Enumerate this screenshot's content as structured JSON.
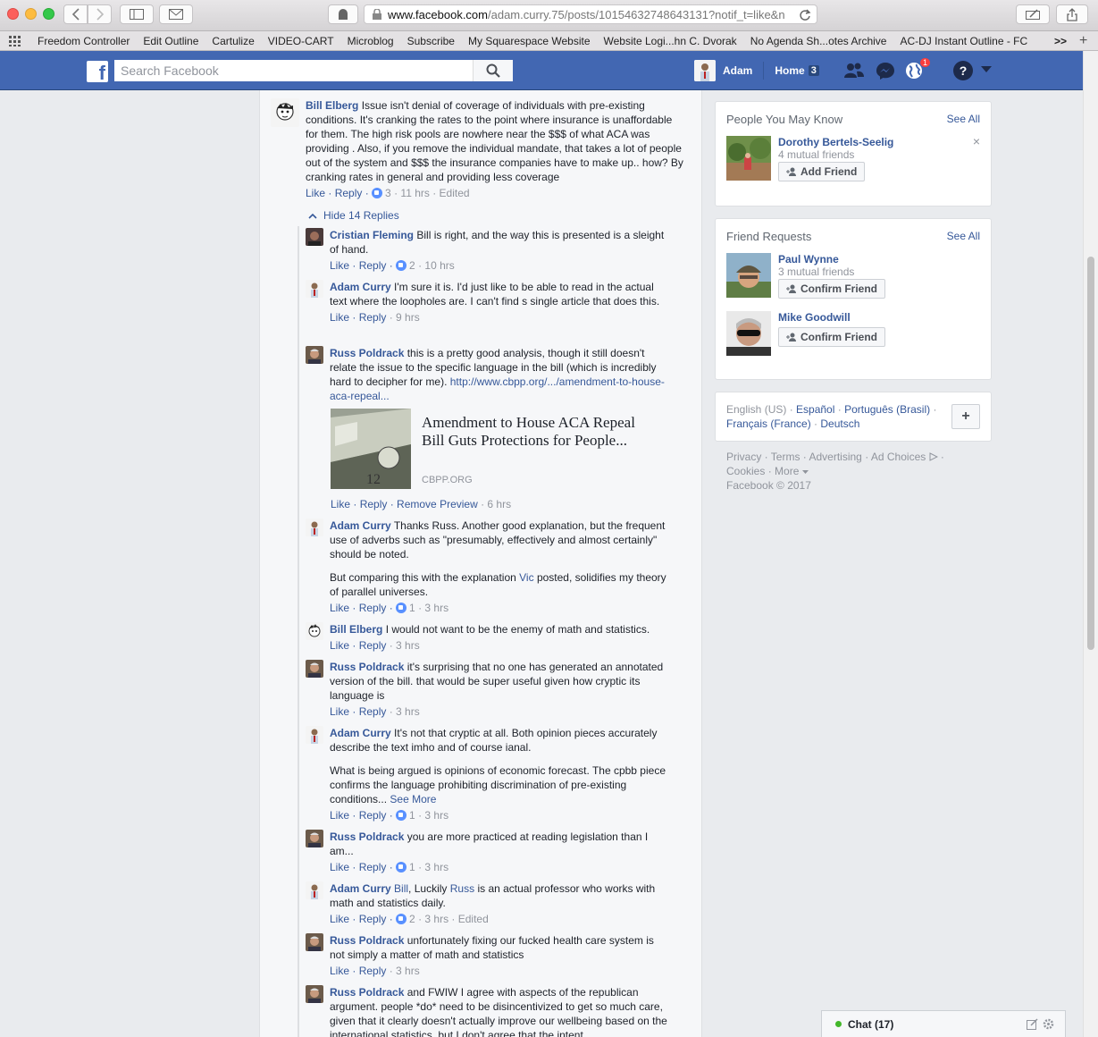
{
  "browser": {
    "url_host": "www.facebook.com",
    "url_path": "/adam.curry.75/posts/10154632748643131?notif_t=like&n",
    "bookmarks": [
      "Freedom Controller",
      "Edit Outline",
      "Cartulize",
      "VIDEO-CART",
      "Microblog",
      "Subscribe",
      "My Squarespace Website",
      "Website Logi...hn C. Dvorak",
      "No Agenda Sh...otes Archive",
      "AC-DJ Instant Outline - FC"
    ],
    "more_bookmarks": ">>",
    "add_tab": "+"
  },
  "fb_bar": {
    "logo": "f",
    "search_placeholder": "Search Facebook",
    "user_name": "Adam",
    "home_label": "Home",
    "home_count": "3",
    "notif_count": "1",
    "help": "?"
  },
  "comments": {
    "root": {
      "author": "Bill Elberg",
      "text": "Issue isn't denial of coverage of individuals with pre-existing conditions. It's cranking the rates to the point where insurance is unaffordable for them. The high risk pools are nowhere near the $$$ of what ACA was providing . Also, if you remove the individual mandate, that takes a lot of people out of the system and $$$ the insurance companies have to make up.. how? By cranking rates in general and providing less coverage",
      "like": "Like",
      "reply": "Reply",
      "likes": "3",
      "meta": "11 hrs · Edited"
    },
    "hide_replies": "Hide 14 Replies",
    "replies": [
      {
        "author": "Cristian Fleming",
        "text": "Bill is right, and the way this is presented is a sleight of hand.",
        "like": "Like",
        "reply": "Reply",
        "likes": "2",
        "meta": "10 hrs"
      },
      {
        "author": "Adam Curry",
        "text": "I'm sure it is. I'd just like to be able to read in the actual text where the loopholes are. I can't find s single article that does this.",
        "like": "Like",
        "reply": "Reply",
        "likes": "",
        "meta": "9 hrs"
      },
      {
        "author": "Russ Poldrack",
        "text": "this is a pretty good analysis, though it still doesn't relate the issue to the specific language in the bill (which is incredibly hard to decipher for me).",
        "link": "http://www.cbpp.org/.../amendment-to-house-aca-repeal...",
        "like": "Like",
        "reply": "Reply",
        "remove": "Remove Preview",
        "meta": "6 hrs"
      },
      {
        "author": "Adam Curry",
        "text": "Thanks Russ. Another good explanation, but the frequent use of adverbs such as \"presumably, effectively and almost certainly\" should be noted.",
        "text2a": "But comparing this with the explanation",
        "mention": "Vic",
        "text2b": "posted, solidifies my theory of parallel universes.",
        "like": "Like",
        "reply": "Reply",
        "likes": "1",
        "meta": "3 hrs"
      },
      {
        "author": "Bill Elberg",
        "text": "I would not want to be the enemy of math and statistics.",
        "like": "Like",
        "reply": "Reply",
        "likes": "",
        "meta": "3 hrs"
      },
      {
        "author": "Russ Poldrack",
        "text": "it's surprising that no one has generated an annotated version of the bill. that would be super useful given how cryptic its language is",
        "like": "Like",
        "reply": "Reply",
        "likes": "",
        "meta": "3 hrs"
      },
      {
        "author": "Adam Curry",
        "text": "It's not that cryptic at all. Both opinion pieces accurately describe the text imho and of course ianal.",
        "text2": "What is being argued is opinions of economic forecast. The cpbb piece confirms the language prohibiting discrimination of pre-existing conditions...",
        "see_more": "See More",
        "like": "Like",
        "reply": "Reply",
        "likes": "1",
        "meta": "3 hrs"
      },
      {
        "author": "Russ Poldrack",
        "text": "you are more practiced at reading legislation than I am...",
        "like": "Like",
        "reply": "Reply",
        "likes": "1",
        "meta": "3 hrs"
      },
      {
        "author": "Adam Curry",
        "mention1": "Bill",
        "text_a": ", Luckily",
        "mention2": "Russ",
        "text_b": "is an actual professor who works with math and statistics daily.",
        "like": "Like",
        "reply": "Reply",
        "likes": "2",
        "meta": "3 hrs · Edited"
      },
      {
        "author": "Russ Poldrack",
        "text": "unfortunately fixing our fucked health care system is not simply a matter of math and statistics",
        "like": "Like",
        "reply": "Reply",
        "likes": "",
        "meta": "3 hrs"
      },
      {
        "author": "Russ Poldrack",
        "text": "and FWIW I agree with aspects of the republican argument. people *do* need to be disincentivized to get so much care, given that it clearly doesn't actually improve our wellbeing based on the international statistics, but I don't agree that the intent"
      }
    ],
    "preview": {
      "title": "Amendment to House ACA Repeal Bill Guts Protections for People...",
      "domain": "CBPP.ORG"
    }
  },
  "sidebar": {
    "pymk": {
      "title": "People You May Know",
      "see_all": "See All",
      "name": "Dorothy Bertels-Seelig",
      "mutual": "4 mutual friends",
      "button": "Add Friend",
      "close": "×"
    },
    "requests": {
      "title": "Friend Requests",
      "see_all": "See All",
      "people": [
        {
          "name": "Paul Wynne",
          "mutual": "3 mutual friends",
          "button": "Confirm Friend"
        },
        {
          "name": "Mike Goodwill",
          "mutual": "",
          "button": "Confirm Friend"
        }
      ]
    },
    "languages": {
      "current": "English (US)",
      "options": [
        "Español",
        "Português (Brasil)",
        "Français (France)",
        "Deutsch"
      ],
      "add": "+"
    },
    "footer": {
      "links": [
        "Privacy",
        "Terms",
        "Advertising",
        "Ad Choices",
        "Cookies",
        "More"
      ],
      "copyright": "Facebook © 2017"
    }
  },
  "chat": {
    "label": "Chat (17)"
  },
  "colors": {
    "fb_blue": "#4267b2",
    "link": "#365899",
    "bg": "#e9ebee"
  }
}
